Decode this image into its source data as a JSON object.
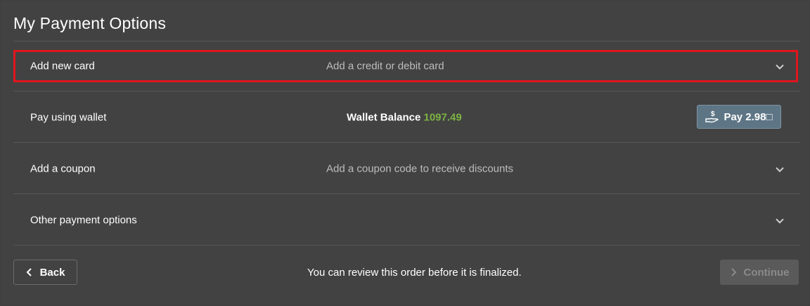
{
  "page": {
    "title": "My Payment Options"
  },
  "rows": {
    "add_card": {
      "label": "Add new card",
      "description": "Add a credit or debit card"
    },
    "wallet": {
      "label": "Pay using wallet",
      "balance_label": "Wallet Balance",
      "balance_value": "1097.49",
      "pay_button_label": "Pay 2.98□"
    },
    "coupon": {
      "label": "Add a coupon",
      "description": "Add a coupon code to receive discounts"
    },
    "other": {
      "label": "Other payment options"
    }
  },
  "footer": {
    "back_label": "Back",
    "note": "You can review this order before it is finalized.",
    "continue_label": "Continue"
  },
  "colors": {
    "background": "#424242",
    "highlight": "#e0161e",
    "balance": "#7cb342",
    "pay_button": "#5d7585"
  },
  "icons": {
    "expand": "chevron-down-icon",
    "pay": "hand-dollar-icon",
    "back": "chevron-left-icon",
    "continue": "chevron-right-icon"
  }
}
